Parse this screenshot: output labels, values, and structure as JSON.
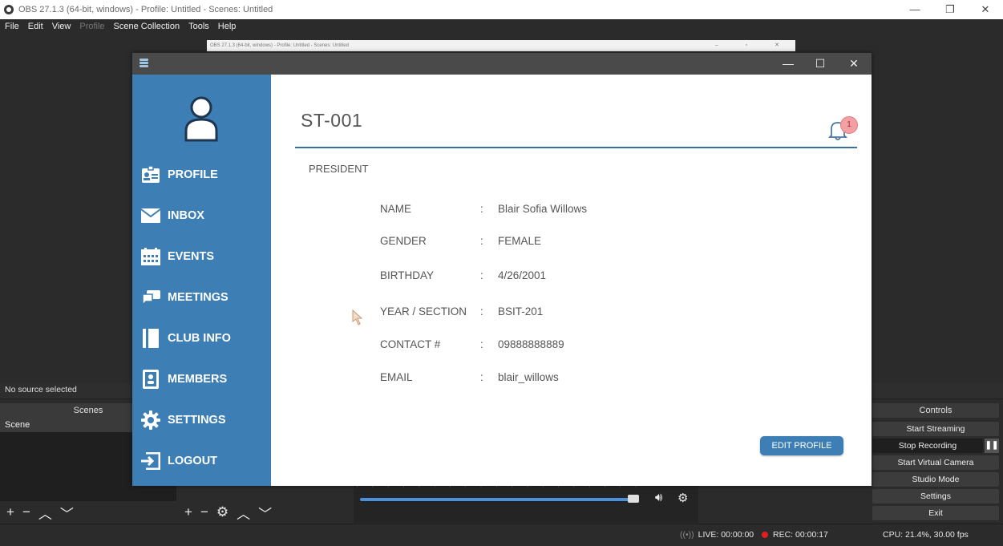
{
  "obs": {
    "title": "OBS 27.1.3 (64-bit, windows) - Profile: Untitled - Scenes: Untitled",
    "window_controls": [
      "—",
      "❐",
      "✕"
    ],
    "menu": [
      "File",
      "Edit",
      "View",
      "Profile",
      "Scene Collection",
      "Tools",
      "Help"
    ],
    "preview_title": "OBS 27.1.3 (64-bit, windows) - Profile: Untitled - Scenes: Untitled",
    "no_source": "No source selected",
    "scenes_header": "Scenes",
    "scene_item": "Scene",
    "controls_header": "Controls",
    "controls": {
      "start_streaming": "Start Streaming",
      "stop_recording": "Stop Recording",
      "start_virtual_camera": "Start Virtual Camera",
      "studio_mode": "Studio Mode",
      "settings": "Settings",
      "exit": "Exit"
    },
    "status": {
      "live": "LIVE: 00:00:00",
      "rec": "REC: 00:00:17",
      "cpu": "CPU: 21.4%, 30.00 fps"
    },
    "audio_volume_fraction": 0.96
  },
  "app": {
    "window_controls": [
      "—",
      "☐",
      "✕"
    ],
    "sidebar": {
      "items": [
        {
          "label": "PROFILE",
          "icon": "profile-card-icon"
        },
        {
          "label": "INBOX",
          "icon": "envelope-icon"
        },
        {
          "label": "EVENTS",
          "icon": "calendar-icon"
        },
        {
          "label": "MEETINGS",
          "icon": "chat-bubbles-icon"
        },
        {
          "label": "CLUB INFO",
          "icon": "book-icon"
        },
        {
          "label": "MEMBERS",
          "icon": "id-badge-icon"
        },
        {
          "label": "SETTINGS",
          "icon": "gear-icon"
        },
        {
          "label": "LOGOUT",
          "icon": "logout-icon"
        }
      ]
    },
    "header": {
      "student_id": "ST-001",
      "notification_count": "1"
    },
    "position": "PRESIDENT",
    "profile_fields": [
      {
        "label": "NAME",
        "value": "Blair Sofia Willows"
      },
      {
        "label": "GENDER",
        "value": "FEMALE"
      },
      {
        "label": "BIRTHDAY",
        "value": "4/26/2001"
      },
      {
        "label": "YEAR / SECTION",
        "value": "BSIT-201"
      },
      {
        "label": "CONTACT #",
        "value": "09888888889"
      },
      {
        "label": "EMAIL",
        "value": "blair_willows"
      }
    ],
    "colon": ":",
    "edit_button": "EDIT PROFILE",
    "colors": {
      "sidebar": "#3d7fb5",
      "titlebar": "#4a4a4a",
      "badge": "#f2a0a3"
    }
  }
}
